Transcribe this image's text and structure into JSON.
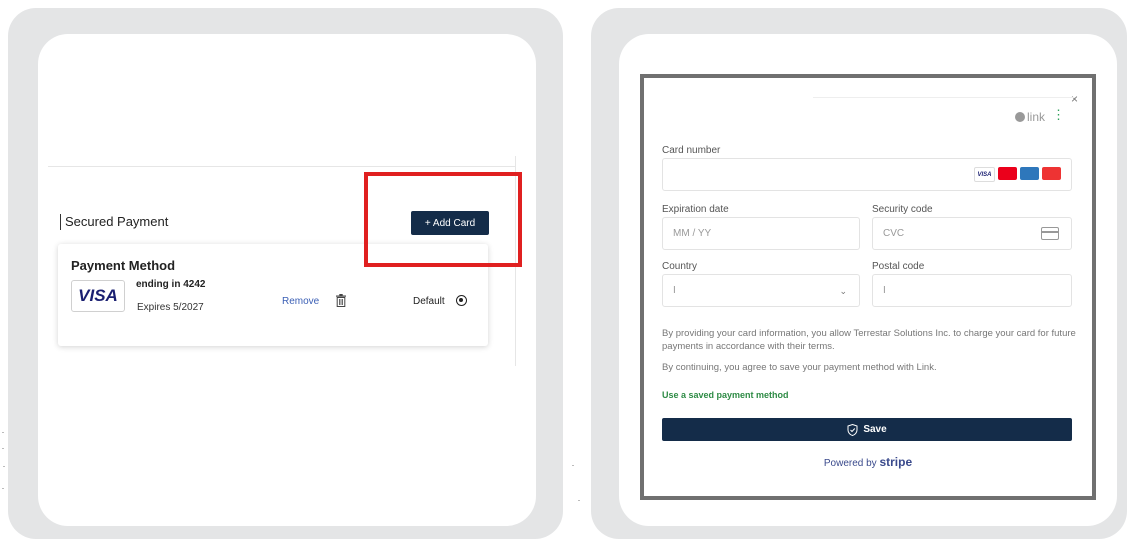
{
  "left": {
    "section_title": "Secured Payment",
    "add_card_label": "+ Add Card",
    "payment_method": {
      "title": "Payment Method",
      "brand": "VISA",
      "ending": "ending in 4242",
      "expires": "Expires 5/2027",
      "remove_label": "Remove",
      "default_label": "Default"
    }
  },
  "modal": {
    "close": "×",
    "link_label": "link",
    "link_more": "⋮",
    "card_number_label": "Card number",
    "card_brands": [
      "VISA",
      "MC",
      "AMEX",
      "JCB"
    ],
    "expiration_label": "Expiration date",
    "expiration_placeholder": "MM / YY",
    "security_label": "Security code",
    "security_placeholder": "CVC",
    "country_label": "Country",
    "country_value": "I",
    "postal_label": "Postal code",
    "postal_value": "I",
    "terms1": "By providing your card information, you allow Terrestar Solutions Inc. to charge your card for future payments in accordance with their terms.",
    "terms2": "By continuing, you agree to save your payment method with Link.",
    "saved_method": "Use a saved payment method",
    "save_label": "Save",
    "powered_prefix": "Powered by",
    "powered_brand": "stripe"
  },
  "colors": {
    "primary": "#142c49",
    "highlight": "#e02020",
    "link_green": "#2e8b45"
  }
}
